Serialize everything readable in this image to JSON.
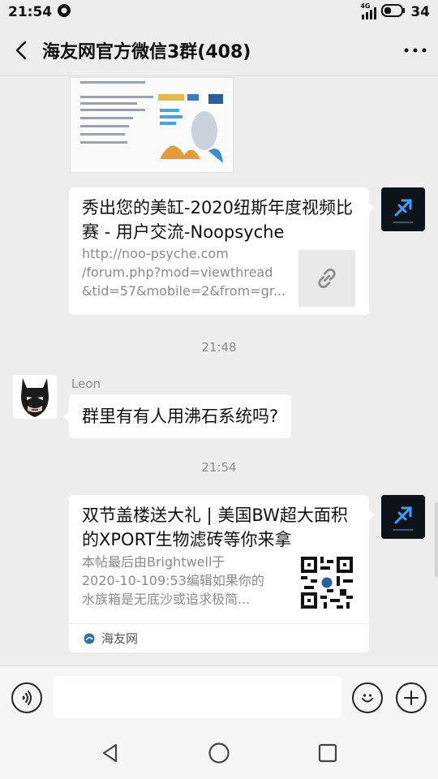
{
  "status_bar": {
    "time": "21:54",
    "network": "4G",
    "battery": "34"
  },
  "header": {
    "title": "海友网官方微信3群(408)"
  },
  "messages": {
    "link_card": {
      "title": "秀出您的美缸-2020纽斯年度视频比赛 - 用户交流-Noopsyche",
      "desc_lines": [
        "http://noo-psyche.com",
        "/forum.php?mod=viewthread",
        "&tid=57&mobile=2&from=gr..."
      ]
    },
    "time_1": "21:48",
    "text_msg": {
      "sender": "Leon",
      "text": "群里有有人用沸石系统吗?"
    },
    "time_2": "21:54",
    "article_card": {
      "title": "双节盖楼送大礼 | 美国BW超大面积的XPORT生物滤砖等你来拿",
      "desc_lines": [
        "本帖最后由Brightwell于",
        "2020-10-109:53编辑如果你的",
        "水族箱是无底沙或追求极简..."
      ],
      "source": "海友网"
    }
  },
  "colors": {
    "background": "#ededed",
    "bubble": "#ffffff",
    "meta_text": "#8a8a8a"
  }
}
